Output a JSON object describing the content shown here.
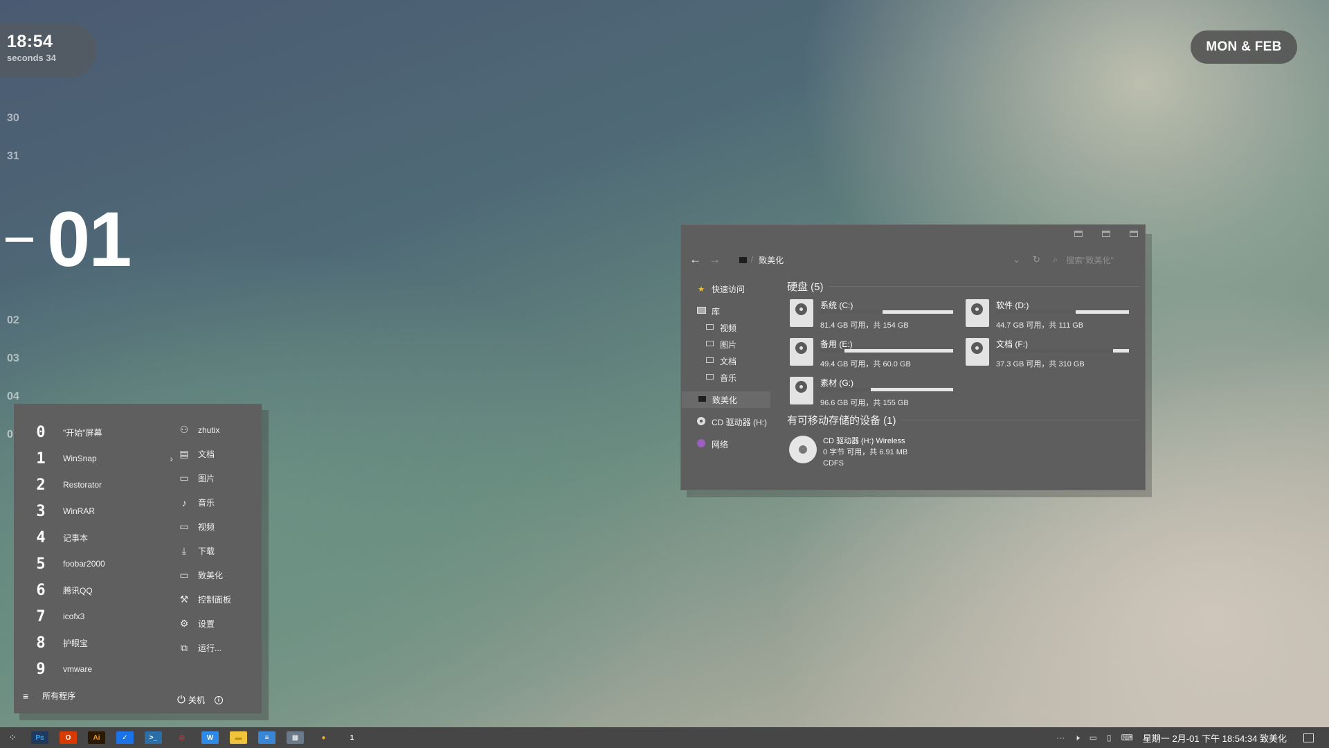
{
  "clock": {
    "time": "18:54",
    "seconds": "seconds 34"
  },
  "date_pill": "MON & FEB",
  "calendar": {
    "before": [
      "30",
      "31"
    ],
    "current": "01",
    "after": [
      "02",
      "03",
      "04",
      "0"
    ]
  },
  "start_menu": {
    "apps": [
      {
        "num": "0",
        "label": "\"开始\"屏幕"
      },
      {
        "num": "1",
        "label": "WinSnap",
        "submenu": "›"
      },
      {
        "num": "2",
        "label": "Restorator"
      },
      {
        "num": "3",
        "label": "WinRAR"
      },
      {
        "num": "4",
        "label": "记事本"
      },
      {
        "num": "5",
        "label": "foobar2000"
      },
      {
        "num": "6",
        "label": "腾讯QQ"
      },
      {
        "num": "7",
        "label": "icofx3"
      },
      {
        "num": "8",
        "label": "护眼宝"
      },
      {
        "num": "9",
        "label": "vmware"
      }
    ],
    "places": [
      {
        "icon": "user-icon",
        "label": "zhutix"
      },
      {
        "icon": "document-icon",
        "label": "文档"
      },
      {
        "icon": "picture-icon",
        "label": "图片"
      },
      {
        "icon": "music-icon",
        "label": "音乐"
      },
      {
        "icon": "video-icon",
        "label": "视频"
      },
      {
        "icon": "download-icon",
        "label": "下载"
      },
      {
        "icon": "computer-icon",
        "label": "致美化"
      },
      {
        "icon": "wrench-icon",
        "label": "控制面板"
      },
      {
        "icon": "gear-icon",
        "label": "设置"
      },
      {
        "icon": "run-icon",
        "label": "运行..."
      }
    ],
    "all_programs": "所有程序",
    "shutdown": "关机",
    "info": "i"
  },
  "explorer": {
    "breadcrumb": "致美化",
    "search_placeholder": "搜索\"致美化\"",
    "sidebar": {
      "quick_access": "快速访问",
      "libraries": "库",
      "lib_items": [
        "视频",
        "图片",
        "文档",
        "音乐"
      ],
      "this_pc": "致美化",
      "cd_drive": "CD 驱动器 (H:)",
      "network": "网络"
    },
    "drives_title": "硬盘 (5)",
    "drives": [
      {
        "name": "系统 (C:)",
        "size": "81.4 GB 可用，共 154 GB",
        "free_fraction": 0.53
      },
      {
        "name": "软件 (D:)",
        "size": "44.7 GB 可用，共 111 GB",
        "free_fraction": 0.4
      },
      {
        "name": "备用 (E:)",
        "size": "49.4 GB 可用，共 60.0 GB",
        "free_fraction": 0.82
      },
      {
        "name": "文档 (F:)",
        "size": "37.3 GB 可用，共 310 GB",
        "free_fraction": 0.12
      },
      {
        "name": "素材 (G:)",
        "size": "96.6 GB 可用，共 155 GB",
        "free_fraction": 0.62
      }
    ],
    "removable_title": "有可移动存储的设备 (1)",
    "cd": {
      "name": "CD 驱动器 (H:) Wireless",
      "size": "0 字节 可用，共 6.91 MB",
      "fs": "CDFS"
    }
  },
  "taskbar": {
    "apps": [
      {
        "icon": "photoshop-icon",
        "text": "Ps",
        "color": "#1e3a5f",
        "fg": "#31a8ff"
      },
      {
        "icon": "office-icon",
        "text": "O",
        "color": "#d83b01",
        "fg": "#ffffff"
      },
      {
        "icon": "illustrator-icon",
        "text": "Ai",
        "color": "#2b1a00",
        "fg": "#ff9a00"
      },
      {
        "icon": "shield-icon",
        "text": "✓",
        "color": "#1a73e8",
        "fg": "#ffffff"
      },
      {
        "icon": "terminal-icon",
        "text": ">_",
        "color": "#2a6fa8",
        "fg": "#ffffff"
      },
      {
        "icon": "netease-music-icon",
        "text": "◎",
        "color": "#464646",
        "fg": "#e83a3a"
      },
      {
        "icon": "whiteboard-icon",
        "text": "W",
        "color": "#2b8be6",
        "fg": "#ffffff"
      },
      {
        "icon": "folder-icon",
        "text": "▬",
        "color": "#f0c33c",
        "fg": "#c08a1a"
      },
      {
        "icon": "notepad-icon",
        "text": "≡",
        "color": "#3a86d6",
        "fg": "#ffffff"
      },
      {
        "icon": "calculator-icon",
        "text": "▦",
        "color": "#6a7a8a",
        "fg": "#ffffff"
      },
      {
        "icon": "chrome-icon",
        "text": "●",
        "color": "#464646",
        "fg": "#e5b03a"
      },
      {
        "icon": "number-one-icon",
        "text": "1",
        "color": "#464646",
        "fg": "#ffffff"
      }
    ],
    "tray_overflow": "···",
    "clock": "星期一 2月-01 下午 18:54:34 致美化"
  },
  "colors": {
    "window_bg": "#5e5e5e",
    "taskbar_bg": "#464646",
    "star": "#f3c233",
    "network": "#9b5fc0"
  }
}
